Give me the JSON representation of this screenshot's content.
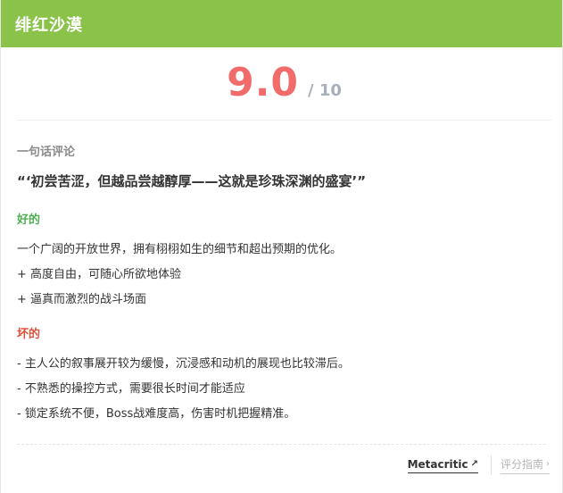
{
  "header": {
    "title": "绯红沙漠"
  },
  "score": {
    "value": "9.0",
    "max": "/ 10"
  },
  "review": {
    "section_label": "一句话评论",
    "quote": "“‘初尝苦涩，但越品尝越醇厚——这就是珍珠深渊的盛宴’”"
  },
  "pros": {
    "label": "好的",
    "summary": "一个广阔的开放世界，拥有栩栩如生的细节和超出预期的优化。",
    "items": [
      "+ 高度自由，可随心所欲地体验",
      "+ 逼真而激烈的战斗场面"
    ]
  },
  "cons": {
    "label": "坏的",
    "items": [
      "- 主人公的叙事展开较为缓慢，沉浸感和动机的展现也比较滞后。",
      "- 不熟悉的操控方式，需要很长时间才能适应",
      "- 锁定系统不便，Boss战难度高，伤害时机把握精准。"
    ]
  },
  "footer": {
    "source_label": "Metacritic",
    "source_icon": "external-link-icon",
    "guide_label": "评分指南",
    "guide_icon": "chevron-right-icon"
  },
  "colors": {
    "header_bg": "#8bc34a",
    "score": "#f26b6b",
    "pros": "#4caf50",
    "cons": "#e0513a"
  }
}
